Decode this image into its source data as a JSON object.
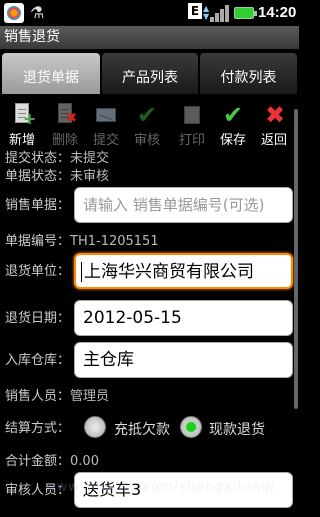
{
  "status_bar": {
    "time": "14:20",
    "network_letter": "E",
    "icons": [
      "app-icon",
      "usb-icon",
      "signal-icon",
      "battery-icon"
    ]
  },
  "title_bar": {
    "title": "销售退货"
  },
  "tabs": [
    {
      "label": "退货单据",
      "selected": true
    },
    {
      "label": "产品列表",
      "selected": false
    },
    {
      "label": "付款列表",
      "selected": false
    }
  ],
  "toolbar": [
    {
      "label": "新增",
      "icon": "new-document-icon",
      "enabled": true
    },
    {
      "label": "删除",
      "icon": "delete-document-icon",
      "enabled": false
    },
    {
      "label": "提交",
      "icon": "submit-envelope-icon",
      "enabled": false
    },
    {
      "label": "审核",
      "icon": "approve-check-icon",
      "enabled": false
    },
    {
      "label": "打印",
      "icon": "print-icon",
      "enabled": false
    },
    {
      "label": "保存",
      "icon": "save-check-icon",
      "enabled": true
    },
    {
      "label": "返回",
      "icon": "back-x-icon",
      "enabled": true
    }
  ],
  "form": {
    "submit_status_label": "提交状态：",
    "submit_status_value": "未提交",
    "doc_status_label": "单据状态：",
    "doc_status_value": "未审核",
    "sales_doc_label": "销售单据：",
    "sales_doc_placeholder": "请输入 销售单据编号(可选)",
    "doc_number_label": "单据编号：",
    "doc_number_value": "TH1-1205151",
    "return_unit_label": "退货单位：",
    "return_unit_value": "上海华兴商贸有限公司",
    "return_date_label": "退货日期：",
    "return_date_value": "2012-05-15",
    "warehouse_label": "入库仓库：",
    "warehouse_value": "主仓库",
    "salesperson_label": "销售人员：",
    "salesperson_value": "管理员",
    "settlement_label": "结算方式：",
    "settlement_options": [
      {
        "label": "充抵欠款",
        "selected": false
      },
      {
        "label": "现款退货",
        "selected": true
      }
    ],
    "total_label": "合计金额：",
    "total_value": "0.00",
    "reviewer_label": "审核人员：",
    "reviewer_value": "送货车3"
  },
  "watermark": "www.sucaitu.com/shengxitong/"
}
